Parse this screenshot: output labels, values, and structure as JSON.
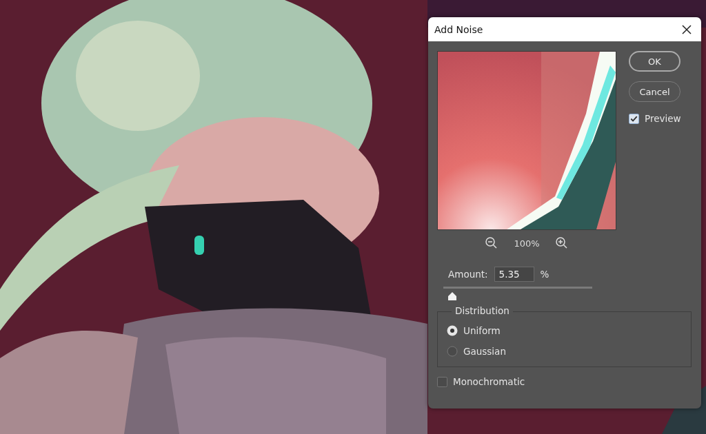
{
  "dialog": {
    "title": "Add Noise",
    "buttons": [
      {
        "label": "OK",
        "default": true
      },
      {
        "label": "Cancel",
        "default": false
      }
    ],
    "preview_checkbox": {
      "label": "Preview",
      "checked": true
    },
    "preview_zoom": "100%",
    "amount": {
      "label": "Amount:",
      "value": "5.35",
      "unit": "%",
      "level": 0.06
    },
    "distribution": {
      "legend": "Distribution",
      "options": [
        {
          "label": "Uniform",
          "selected": true
        },
        {
          "label": "Gaussian",
          "selected": false
        }
      ]
    },
    "monochromatic": {
      "label": "Monochromatic",
      "checked": false
    }
  }
}
